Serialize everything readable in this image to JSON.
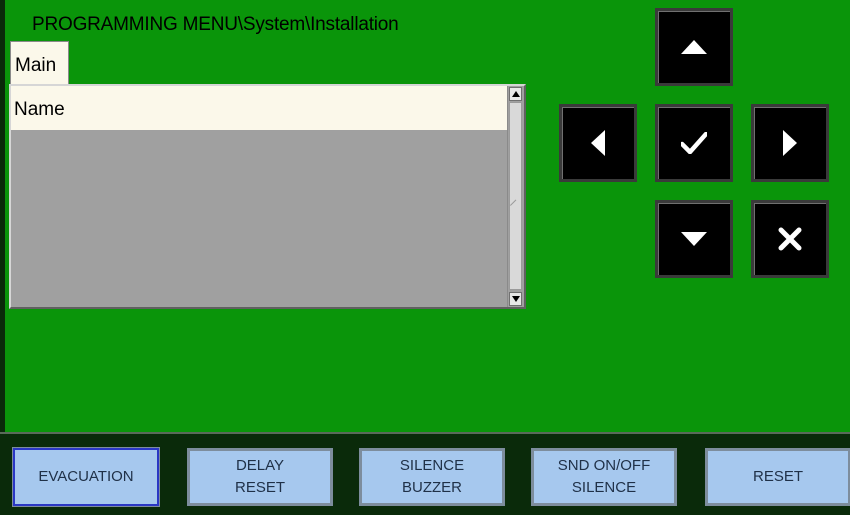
{
  "header": {
    "title": "PROGRAMMING MENU\\System\\Installation"
  },
  "tabs": [
    {
      "label": "Main"
    }
  ],
  "list": {
    "items": [
      {
        "label": "Name"
      }
    ]
  },
  "nav": {
    "up": "arrow-up-icon",
    "left": "arrow-left-icon",
    "ok": "checkmark-icon",
    "right": "arrow-right-icon",
    "down": "arrow-down-icon",
    "cancel": "cross-icon"
  },
  "footer": {
    "buttons": [
      {
        "line1": "EVACUATION",
        "line2": ""
      },
      {
        "line1": "DELAY",
        "line2": "RESET"
      },
      {
        "line1": "SILENCE",
        "line2": "BUZZER"
      },
      {
        "line1": "SND ON/OFF",
        "line2": "SILENCE"
      },
      {
        "line1": "RESET",
        "line2": ""
      }
    ]
  },
  "colors": {
    "panel": "#0a950a",
    "background": "#0a2a0a",
    "button": "#a6c8ee",
    "row": "#fbf8ea",
    "nav": "#000000"
  }
}
